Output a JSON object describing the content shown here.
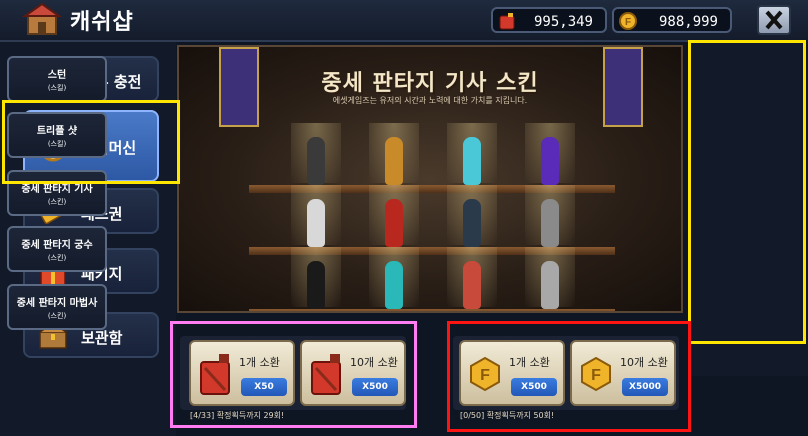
{
  "header": {
    "title": "캐쉬샵",
    "currency_oil": "995,349",
    "currency_gold": "988,999"
  },
  "sidebar": {
    "items": [
      {
        "label": "석유 충전"
      },
      {
        "label": "타임머신"
      },
      {
        "label": "패스권"
      },
      {
        "label": "패키지"
      },
      {
        "label": "보관함"
      }
    ]
  },
  "banner": {
    "title": "중세 판타지 기사 스킨",
    "subtitle": "에셋게임즈는 유저의 시간과 노력에 대한 가치를 지킵니다."
  },
  "right_menu": [
    {
      "main": "스턴",
      "sub": "(스킬)"
    },
    {
      "main": "트리플 샷",
      "sub": "(스킬)"
    },
    {
      "main": "중세 판타지 기사",
      "sub": "(스킨)"
    },
    {
      "main": "중세 판타지 궁수",
      "sub": "(스킨)"
    },
    {
      "main": "중세 판타지 마법사",
      "sub": "(스킨)"
    }
  ],
  "summons": {
    "oil_1": {
      "label": "1개 소환",
      "price": "X50"
    },
    "oil_10": {
      "label": "10개 소환",
      "price": "X500"
    },
    "gold_1": {
      "label": "1개 소환",
      "price": "X500"
    },
    "gold_10": {
      "label": "10개 소환",
      "price": "X5000"
    },
    "oil_progress": "[4/33] 확정획득까지 29회!",
    "gold_progress": "[0/50] 확정획득까지 50회!"
  },
  "colors": {
    "highlight_yellow": "#ffe600",
    "highlight_pink": "#ff7cf2",
    "highlight_red": "#ff1414",
    "active_tab": "#3d6cc0"
  }
}
